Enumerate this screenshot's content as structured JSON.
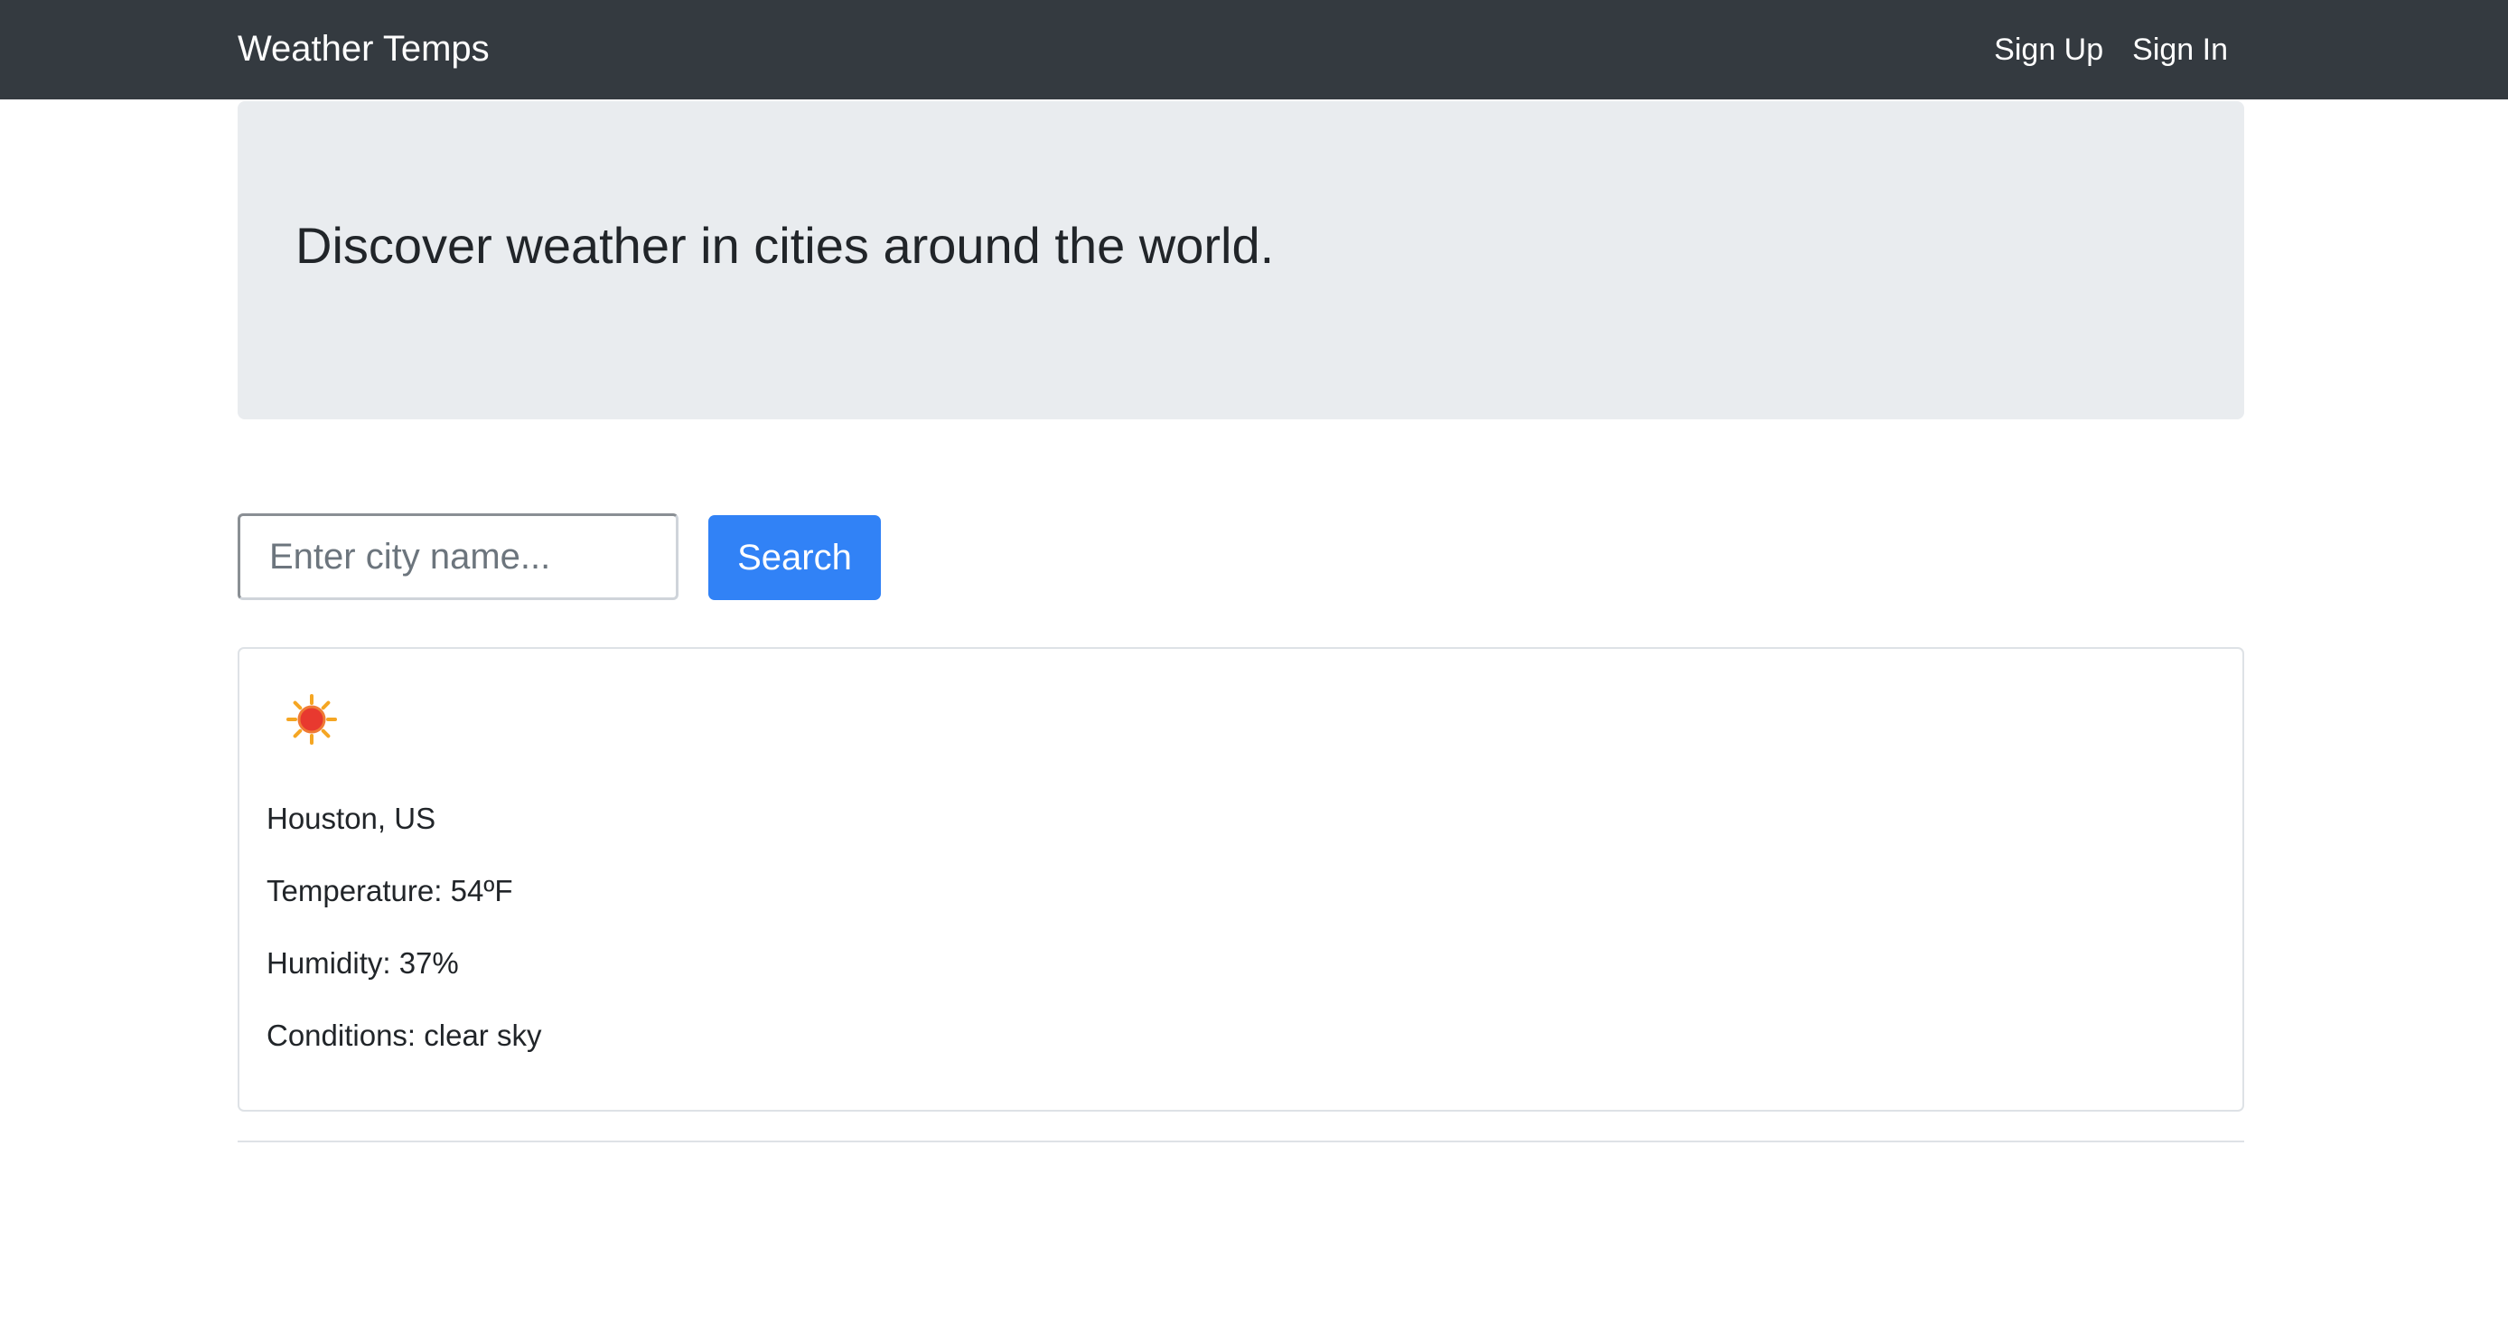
{
  "navbar": {
    "brand": "Weather Temps",
    "links": [
      "Sign Up",
      "Sign In"
    ]
  },
  "hero": {
    "heading": "Discover weather in cities around the world."
  },
  "search": {
    "placeholder": "Enter city name...",
    "value": "",
    "button_label": "Search"
  },
  "weather_card": {
    "icon": "sun-icon",
    "location": "Houston, US",
    "temperature": "Temperature: 54ºF",
    "humidity": "Humidity: 37%",
    "conditions": "Conditions: clear sky"
  },
  "colors": {
    "navbar_bg": "#343a40",
    "hero_bg": "#e9ecef",
    "primary_button": "#3182f6"
  }
}
